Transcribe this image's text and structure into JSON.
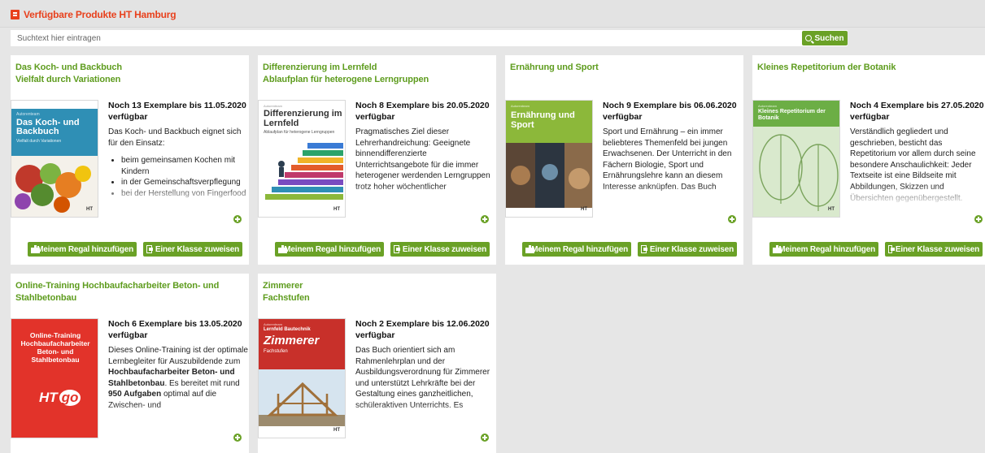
{
  "header": {
    "title": "Verfügbare Produkte HT Hamburg",
    "accent": "#e8401c"
  },
  "search": {
    "placeholder": "Suchtext hier eintragen",
    "button_label": "Suchen"
  },
  "accent_green": "#6aa126",
  "cards": [
    {
      "title_line1": "Das Koch- und Backbuch",
      "title_line2": "Vielfalt durch Variationen",
      "availability": "Noch 13 Exemplare bis 11.05.2020 verfügbar",
      "desc_intro": "Das Koch- und Backbuch eignet sich für den Einsatz:",
      "desc_bullets": [
        "beim gemeinsamen Kochen mit Kindern",
        "in der Gemeinschaftsverpflegung",
        "bei der Herstellung von Fingerfood"
      ],
      "cover": {
        "title": "Das Koch- und Backbuch",
        "subtitle": "Vielfalt durch Variationen",
        "color": "#2f8fb5"
      },
      "btn_shelf": "Meinem Regal hinzufügen",
      "btn_class": "Einer Klasse zuweisen"
    },
    {
      "title_line1": "Differenzierung im Lernfeld",
      "title_line2": "Ablaufplan für heterogene Lerngruppen",
      "availability": "Noch 8 Exemplare bis 20.05.2020 verfügbar",
      "desc_text": "Pragmatisches Ziel dieser Lehrerhandreichung: Geeignete binnendifferenzierte Unterrichtsangebote für die immer heterogener werdenden Lerngruppen trotz hoher wöchentlicher",
      "cover": {
        "title": "Differenzierung im Lernfeld",
        "subtitle": "Ablaufplan für heterogene Lerngruppen"
      },
      "btn_shelf": "Meinem Regal hinzufügen",
      "btn_class": "Einer Klasse zuweisen"
    },
    {
      "title_line1": "Ernährung und Sport",
      "title_line2": "",
      "availability": "Noch 9 Exemplare bis 06.06.2020 verfügbar",
      "desc_text": "Sport und Ernährung – ein immer beliebteres Themenfeld bei jungen Erwachsenen. Der Unterricht in den Fächern Biologie, Sport und Ernährungslehre kann an diesem Interesse anknüpfen. Das Buch",
      "cover": {
        "title": "Ernährung und Sport",
        "color": "#8cb83a"
      },
      "btn_shelf": "Meinem Regal hinzufügen",
      "btn_class": "Einer Klasse zuweisen"
    },
    {
      "title_line1": "Kleines Repetitorium der Botanik",
      "title_line2": "",
      "availability": "Noch 4 Exemplare bis 27.05.2020 verfügbar",
      "desc_text": "Verständlich gegliedert und geschrieben, besticht das Repetitorium vor allem durch seine besondere Anschaulichkeit: Jeder Textseite ist eine Bildseite mit Abbildungen, Skizzen und Übersichten gegenübergestellt.",
      "cover": {
        "title": "Kleines Repetitorium der Botanik",
        "color": "#6cae45"
      },
      "btn_shelf": "Meinem Regal hinzufügen",
      "btn_class": "Einer Klasse zuweisen"
    },
    {
      "title_line1": "Online-Training Hochbaufacharbeiter Beton- und",
      "title_line2": "Stahlbetonbau",
      "availability": "Noch 6 Exemplare bis 13.05.2020 verfügbar",
      "desc_a": "Dieses Online-Training ist der optimale Lernbegleiter für Auszubildende zum ",
      "desc_b": "Hochbaufacharbeiter Beton- und Stahlbetonbau",
      "desc_c": ". Es bereitet mit rund ",
      "desc_d": "950 Aufgaben",
      "desc_e": " optimal auf die Zwischen- und",
      "cover": {
        "line1": "Online-Training",
        "line2": "Hochbaufacharbeiter",
        "line3": "Beton- und",
        "line4": "Stahlbetonbau",
        "brand": "HT",
        "brand2": "go",
        "color": "#e2332a"
      }
    },
    {
      "title_line1": "Zimmerer",
      "title_line2": "Fachstufen",
      "availability": "Noch 2 Exemplare bis 12.06.2020 verfügbar",
      "desc_text": "Das Buch orientiert sich am Rahmenlehrplan und der Ausbildungsverordnung für Zimmerer und unterstützt Lehrkräfte bei der Gestaltung eines ganzheitlichen, schüleraktiven Unterrichts. Es",
      "cover": {
        "kicker": "Lernfeld Bautechnik",
        "title": "Zimmerer",
        "subtitle": "Fachstufen",
        "color": "#c8302a"
      }
    }
  ]
}
